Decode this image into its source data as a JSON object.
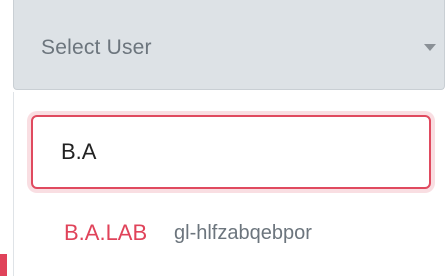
{
  "select": {
    "placeholder": "Select User",
    "caret_icon": "caret-down-icon"
  },
  "dropdown": {
    "search": {
      "value": "B.A",
      "placeholder": ""
    },
    "options": [
      {
        "label": "B.A.LAB",
        "sublabel": "gl-hlfzabqebpor"
      }
    ]
  },
  "colors": {
    "accent": "#e0435a",
    "select_bg": "#dde2e6",
    "muted_text": "#6c757d"
  }
}
